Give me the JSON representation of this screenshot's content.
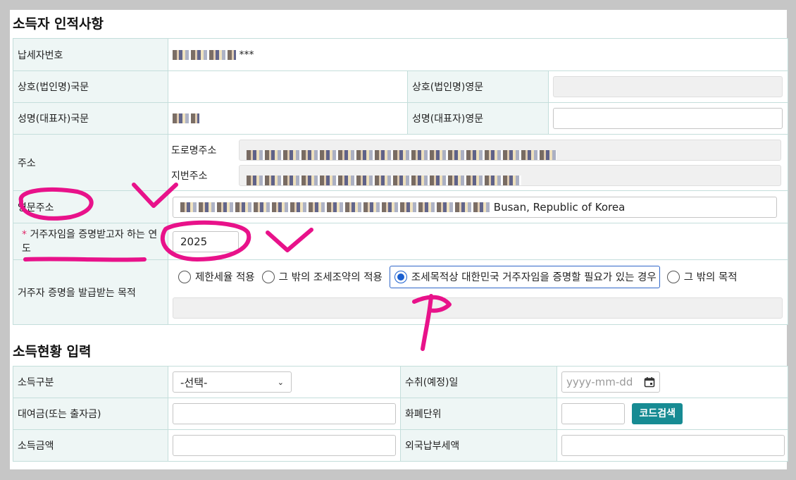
{
  "section1": {
    "title": "소득자 인적사항",
    "taxpayer_no": {
      "label": "납세자번호",
      "value": "***"
    },
    "name_kr": {
      "label": "상호(법인명)국문"
    },
    "name_en": {
      "label": "상호(법인명)영문"
    },
    "rep_kr": {
      "label": "성명(대표자)국문"
    },
    "rep_en": {
      "label": "성명(대표자)영문"
    },
    "address": {
      "label": "주소",
      "road_label": "도로명주소",
      "lot_label": "지번주소"
    },
    "address_en": {
      "label": "영문주소",
      "value_suffix": "Busan, Republic of Korea"
    },
    "year": {
      "required_mark": "*",
      "label": "거주자임을 증명받고자 하는 연도",
      "value": "2025"
    },
    "purpose": {
      "label": "거주자 증명을 발급받는 목적",
      "options": [
        "제한세율 적용",
        "그 밖의 조세조약의 적용",
        "조세목적상 대한민국 거주자임을 증명할 필요가 있는 경우",
        "그 밖의 목적"
      ],
      "selected_index": 2
    }
  },
  "section2": {
    "title": "소득현황 입력",
    "income_type": {
      "label": "소득구분",
      "value": "-선택-"
    },
    "receipt_date": {
      "label": "수취(예정)일",
      "placeholder": "yyyy-mm-dd"
    },
    "loan_amount": {
      "label": "대여금(또는 출자금)"
    },
    "currency": {
      "label": "화폐단위",
      "button": "코드검색"
    },
    "income_amount": {
      "label": "소득금액"
    },
    "foreign_tax": {
      "label": "외국납부세액"
    }
  },
  "annotation_color": "#e8128a"
}
